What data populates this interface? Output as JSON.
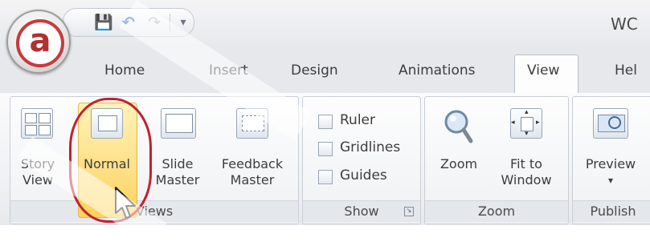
{
  "window": {
    "title_visible": "WC"
  },
  "app_orb": {
    "letter": "a"
  },
  "quick_access": {
    "save": "💾",
    "undo": "↶",
    "redo": "↷",
    "customize": "▾"
  },
  "tabs": [
    {
      "label": "Home"
    },
    {
      "label": "Insert"
    },
    {
      "label": "Design"
    },
    {
      "label": "Animations"
    },
    {
      "label": "View",
      "active": true
    },
    {
      "label": "Hel"
    }
  ],
  "groups": {
    "views": {
      "label": "Views",
      "buttons": [
        {
          "line1": "Story",
          "line2": "View"
        },
        {
          "line1": "Normal",
          "line2": "",
          "selected": true
        },
        {
          "line1": "Slide",
          "line2": "Master"
        },
        {
          "line1": "Feedback",
          "line2": "Master"
        }
      ]
    },
    "show": {
      "label": "Show",
      "checkboxes": [
        {
          "label": "Ruler",
          "checked": false
        },
        {
          "label": "Gridlines",
          "checked": false
        },
        {
          "label": "Guides",
          "checked": false
        }
      ]
    },
    "zoom": {
      "label": "Zoom",
      "buttons": [
        {
          "line1": "Zoom",
          "line2": ""
        },
        {
          "line1": "Fit to",
          "line2": "Window"
        }
      ]
    },
    "publish": {
      "label": "Publish",
      "buttons": [
        {
          "line1": "Preview",
          "line2": "▾"
        }
      ]
    }
  },
  "colors": {
    "highlight": "#ffe08a",
    "ring": "#c2202d",
    "orb_ring": "#c93a3a"
  }
}
